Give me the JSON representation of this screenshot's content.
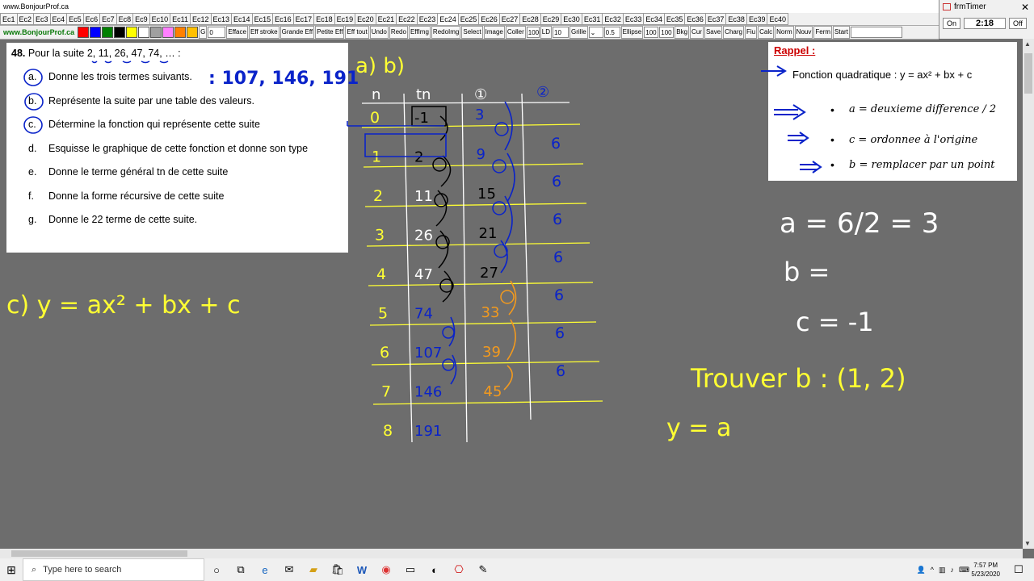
{
  "window": {
    "title": "www.BonjourProf.ca"
  },
  "tabs": [
    "Ec1",
    "Ec2",
    "Ec3",
    "Ec4",
    "Ec5",
    "Ec6",
    "Ec7",
    "Ec8",
    "Ec9",
    "Ec10",
    "Ec11",
    "Ec12",
    "Ec13",
    "Ec14",
    "Ec15",
    "Ec16",
    "Ec17",
    "Ec18",
    "Ec19",
    "Ec20",
    "Ec21",
    "Ec22",
    "Ec23",
    "Ec24",
    "Ec25",
    "Ec26",
    "Ec27",
    "Ec28",
    "Ec29",
    "Ec30",
    "Ec31",
    "Ec32",
    "Ec33",
    "Ec34",
    "Ec35",
    "Ec36",
    "Ec37",
    "Ec38",
    "Ec39",
    "Ec40"
  ],
  "active_tab": "Ec24",
  "toolbar": {
    "site": "www.BonjourProf.ca",
    "colors": [
      "#ff0000",
      "#0000ff",
      "#008000",
      "#000000",
      "#ffff00",
      "#ffffff",
      "#a0a0a0",
      "#ff80ff",
      "#ff8000",
      "#ffc000"
    ],
    "g_label": "G",
    "size_value": "0",
    "buttons": [
      "Efface",
      "Eff stroke",
      "Grande Eff",
      "Petite Eff",
      "Eff tout",
      "Undo",
      "Redo",
      "EffImg",
      "RedoImg",
      "Select",
      "Image",
      "Coller"
    ],
    "opacity_value": "100",
    "ld_label": "LD",
    "ld_value": "10",
    "grid_label": "Grille",
    "grid_value": "0.5",
    "ellipse_label": "Ellipse",
    "ellipse_w": "100",
    "ellipse_h": "100",
    "buttons2": [
      "Bkg",
      "Cur",
      "Save",
      "Charg",
      "Fiu",
      "Calc",
      "Norm",
      "Nouv",
      "Ferm",
      "Start"
    ]
  },
  "timer": {
    "title": "frmTimer",
    "on_label": "On",
    "time": "2:18",
    "off_label": "Off"
  },
  "problem": {
    "number": "48.",
    "intro": "Pour la suite 2, 11, 26, 47, 74, … :",
    "items": [
      {
        "letter": "a.",
        "text": "Donne les trois termes suivants."
      },
      {
        "letter": "b.",
        "text": "Représente la suite par une table des valeurs."
      },
      {
        "letter": "c.",
        "text": "Détermine la fonction qui représente cette suite"
      },
      {
        "letter": "d.",
        "text": "Esquisse le graphique de cette fonction et donne son type"
      },
      {
        "letter": "e.",
        "text": "Donne le terme général tn de cette suite"
      },
      {
        "letter": "f.",
        "text": "Donne la forme récursive de cette suite"
      },
      {
        "letter": "g.",
        "text": "Donne le 22 terme de cette suite."
      }
    ]
  },
  "rappel": {
    "title": "Rappel :",
    "line": "Fonction quadratique : y = ax² + bx + c",
    "bullets": [
      "a = deuxieme difference / 2",
      "c = ordonnee à l'origine",
      "b = remplacer par un point"
    ]
  },
  "handwriting": {
    "answer_a": ": 107, 146, 191",
    "label_ab": "a) b)",
    "headers": [
      "n",
      "tn",
      "①",
      "②"
    ],
    "n": [
      "0",
      "1",
      "2",
      "3",
      "4",
      "5",
      "6",
      "7",
      "8"
    ],
    "tn": [
      "-1",
      "2",
      "11",
      "26",
      "47",
      "74",
      "107",
      "146",
      "191"
    ],
    "first_diff": [
      "3",
      "9",
      "15",
      "21",
      "27",
      "33",
      "39",
      "45"
    ],
    "second_diff": [
      "6",
      "6",
      "6",
      "6",
      "6",
      "6",
      "6"
    ],
    "c_eq": "c) y = ax² + bx + c",
    "a_eq": "a = 6/2 = 3",
    "b_eq": "b =",
    "c_val": "c = -1",
    "trouver": "Trouver b : (1, 2)",
    "y_eq": "y = a"
  },
  "taskbar": {
    "search_placeholder": "Type here to search",
    "time": "7:57 PM",
    "date": "5/23/2020"
  }
}
